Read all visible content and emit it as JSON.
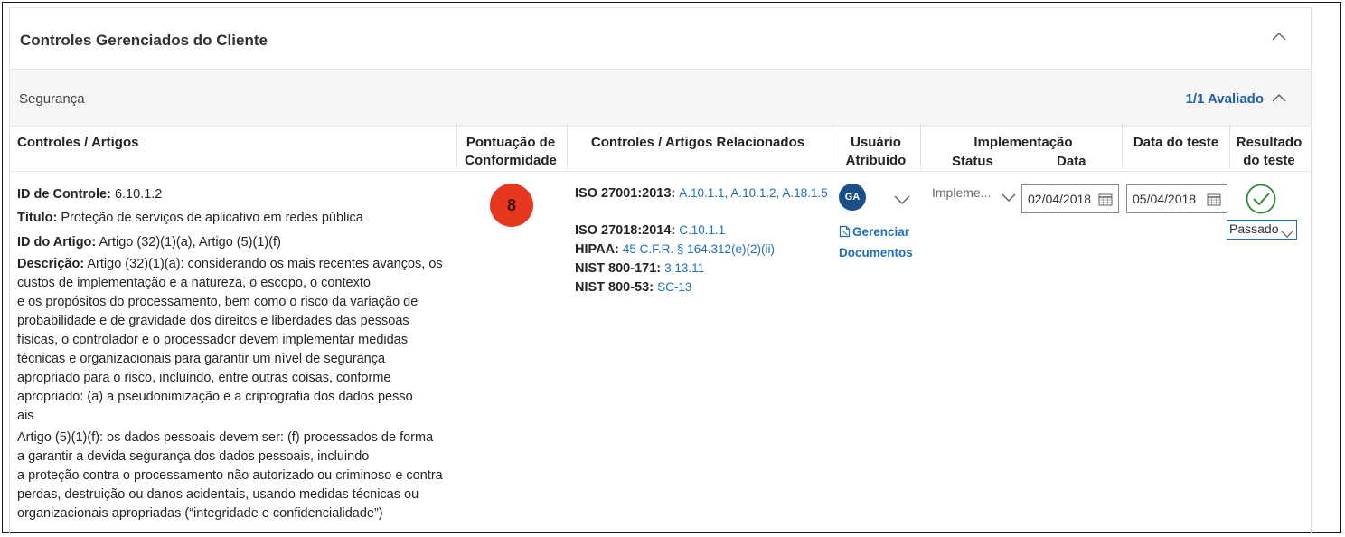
{
  "card": {
    "title": "Controles Gerenciados do Cliente"
  },
  "section": {
    "name": "Segurança",
    "evaluated": "1/1 Avaliado"
  },
  "table": {
    "headers": {
      "controls": "Controles / Artigos",
      "score_line1": "Pontuação de",
      "score_line2": "Conformidade",
      "related": "Controles / Artigos Relacionados",
      "user_line1": "Usuário",
      "user_line2": "Atribuído",
      "impl_line1": "Implementação",
      "impl_status": "Status",
      "impl_date": "Data",
      "test_date": "Data do teste",
      "result_line1": "Resultado",
      "result_line2": "do teste"
    },
    "row": {
      "control_id_label": "ID de Controle:",
      "control_id": "6.10.1.2",
      "title_label": "Título:",
      "title": "Proteção de serviços de aplicativo em redes pública",
      "article_id_label": "ID do Artigo:",
      "article_id": "Artigo (32)(1)(a), Artigo (5)(1)(f)",
      "description_label": "Descrição:",
      "description_lines": [
        "Artigo (32)(1)(a): considerando os mais recentes avanços, os",
        "custos de implementação e a natureza, o escopo, o contexto",
        "e os propósitos do processamento, bem como o risco da variação de",
        "probabilidade e de gravidade dos direitos e liberdades das pessoas",
        "físicas, o controlador e o processador devem implementar medidas",
        "técnicas e organizacionais para garantir um nível de segurança",
        "apropriado para o risco, incluindo, entre outras coisas, conforme",
        "apropriado: (a) a pseudonimização e a criptografia dos dados pesso",
        "ais"
      ],
      "article2_lines": [
        "Artigo (5)(1)(f): os dados pessoais devem ser: (f) processados de forma",
        "a garantir a devida segurança dos dados pessoais, incluindo",
        "a proteção contra o processamento não autorizado ou criminoso e contra",
        "perdas, destruição ou danos acidentais, usando medidas técnicas ou",
        "organizacionais apropriadas (“integridade e confidencialidade”)"
      ],
      "score": "8",
      "related": [
        {
          "label": "ISO 27001:2013:",
          "value": "A.10.1.1, A.10.1.2, A.18.1.5"
        },
        {
          "label": "ISO 27018:2014:",
          "value": "C.10.1.1"
        },
        {
          "label": "HIPAA:",
          "value": "45 C.F.R. § 164.312(e)(2)(ii)"
        },
        {
          "label": "NIST 800-171:",
          "value": "3.13.11"
        },
        {
          "label": "NIST 800-53:",
          "value": "SC-13"
        }
      ],
      "user_initials": "GA",
      "manage_line1": "Gerenciar",
      "manage_line2": "Documentos",
      "impl_status": "Impleme...",
      "impl_date": "02/04/2018",
      "test_date": "05/04/2018",
      "result": "Passado"
    }
  },
  "colors": {
    "accent": "#1d6fb8",
    "score": "#e8371f",
    "pass": "#2e8b3a",
    "avatar": "#1a4f8b"
  }
}
